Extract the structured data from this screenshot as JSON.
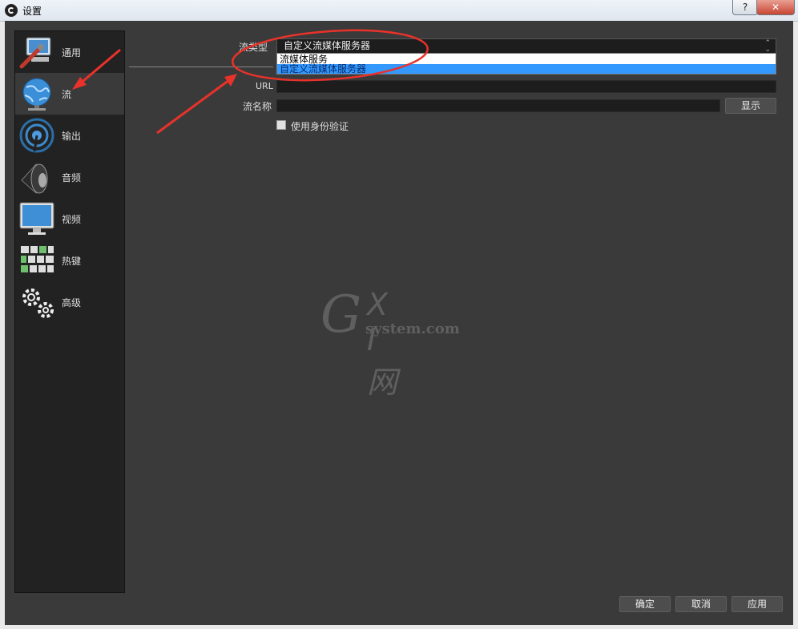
{
  "window": {
    "title": "设置",
    "help_label": "?",
    "close_label": "✕"
  },
  "sidebar": {
    "items": [
      {
        "label": "通用",
        "icon": "general-icon",
        "active": false
      },
      {
        "label": "流",
        "icon": "globe-icon",
        "active": true
      },
      {
        "label": "输出",
        "icon": "output-icon",
        "active": false
      },
      {
        "label": "音频",
        "icon": "speaker-icon",
        "active": false
      },
      {
        "label": "视频",
        "icon": "monitor-icon",
        "active": false
      },
      {
        "label": "热键",
        "icon": "keyboard-icon",
        "active": false
      },
      {
        "label": "高级",
        "icon": "gears-icon",
        "active": false
      }
    ]
  },
  "stream": {
    "type_label": "流类型",
    "type_value": "自定义流媒体服务器",
    "dropdown_options": [
      "流媒体服务",
      "自定义流媒体服务器"
    ],
    "url_label": "URL",
    "key_label": "流名称",
    "show_button": "显示",
    "auth_label": "使用身份验证"
  },
  "footer": {
    "ok": "确定",
    "cancel": "取消",
    "apply": "应用"
  },
  "watermark": {
    "g": "G",
    "xi": "X I 网",
    "sub": "system.com"
  },
  "colors": {
    "accent_annotation": "#e8322a",
    "selection": "#3399ff"
  }
}
